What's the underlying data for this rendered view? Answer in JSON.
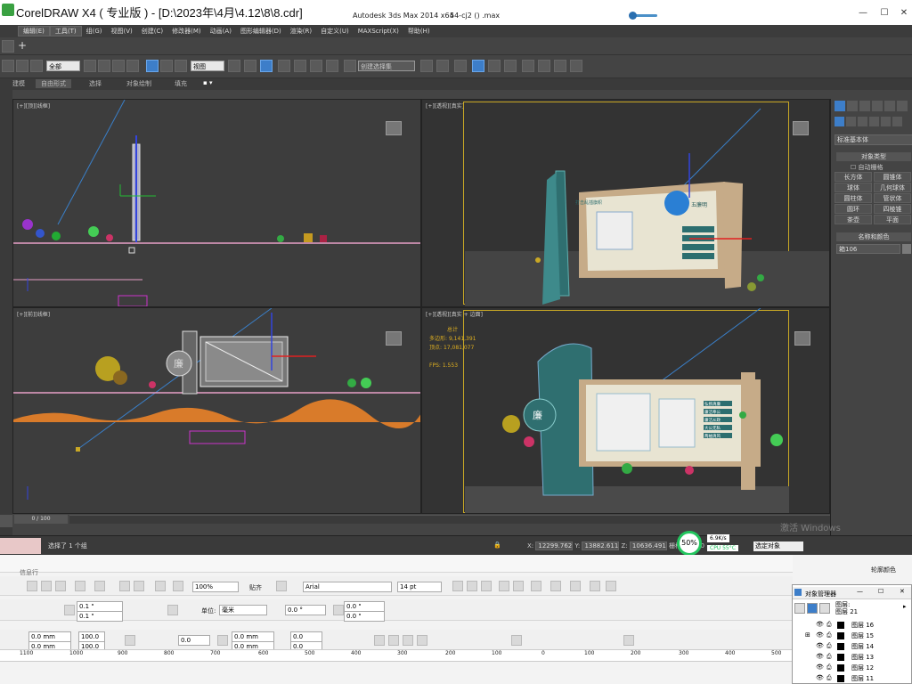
{
  "titlebar": {
    "corel_title": "CorelDRAW X4 ( 专业版 ) - [D:\\2023年\\4月\\4.12\\8\\8.cdr]",
    "max_title": "Autodesk 3ds Max  2014 x64",
    "max_file": "54-cj2 ()  .max"
  },
  "menus": [
    "编辑(E)",
    "工具(T)",
    "组(G)",
    "视图(V)",
    "创建(C)",
    "修改器(M)",
    "动画(A)",
    "图形编辑器(D)",
    "渲染(R)",
    "自定义(U)",
    "MAXScript(X)",
    "帮助(H)"
  ],
  "toolbar": {
    "selection_filter": "全部",
    "reference_coord": "视图",
    "named_selection": "创建选择集"
  },
  "ribbon_tabs": [
    "建模",
    "自由形式",
    "选择",
    "对象绘制",
    "填充"
  ],
  "viewports": {
    "top_left": "[+][顶][线框]",
    "top_right": "[+][透视][真实]",
    "bottom_left": "[+][前][线框]",
    "bottom_right": "[+][透视][真实 + 边面]",
    "stats": {
      "total_label": "总计",
      "polys_label": "多边形:",
      "polys": "9,141,391",
      "verts_label": "顶点:",
      "verts": "17,081,077",
      "fps_label": "FPS:",
      "fps": "1.553"
    }
  },
  "scene_text": {
    "sign_header": "打击乱插旗帜",
    "sign_title": "五廉明",
    "pillar_char": "廉",
    "lines": [
      "弘扬清廉",
      "廉洁奉公",
      "廉洁从政",
      "大公无私",
      "两袖清风"
    ]
  },
  "command_panel": {
    "dropdown": "标准基本体",
    "object_type_label": "对象类型",
    "autogrid": "自动栅格",
    "buttons": [
      "长方体",
      "圆锥体",
      "球体",
      "几何球体",
      "圆柱体",
      "管状体",
      "圆环",
      "四棱锥",
      "茶壶",
      "平面"
    ],
    "name_color_label": "名称和颜色",
    "object_name": "箱106"
  },
  "statusbar": {
    "timeline": "0 / 100",
    "status_text": "选择了 1 个组",
    "x_label": "X:",
    "x": "12299.762",
    "y_label": "Y:",
    "y": "13882.611",
    "z_label": "Z:",
    "z": "10636.491",
    "grid_label": "栅格 =",
    "grid": "10.0",
    "cpu_percent": "50%",
    "net_speed": "6.9K/s",
    "cpu_label": "CPU 55°C",
    "select_object": "选定对象",
    "activate_windows": "激活 Windows"
  },
  "corel": {
    "prompt": "信息行",
    "zoom": "100%",
    "snap": "贴齐",
    "font": "Arial",
    "font_size": "14 pt",
    "dim1": "0.1 \"",
    "dim2": "0.1 \"",
    "unit_label": "单位:",
    "unit": "毫米",
    "angle": "0.0 °",
    "dup1": "0.0 \"",
    "dup2": "0.0 \"",
    "mm1": "0.0 mm",
    "mm2": "0.0 mm",
    "pct1": "100.0",
    "pct2": "100.0",
    "rot": "0.0",
    "mm3": "0.0 mm",
    "mm4": "0.0 mm",
    "v1": "0.0",
    "v2": "0.0",
    "outline_color": "轮廓颜色",
    "ruler_ticks": [
      "1100",
      "1000",
      "900",
      "800",
      "700",
      "600",
      "500",
      "400",
      "300",
      "200",
      "100",
      "0",
      "100",
      "200",
      "300",
      "400",
      "500"
    ]
  },
  "object_manager": {
    "title": "对象管理器",
    "header_line1": "图层:",
    "header_line2": "图层 21",
    "layers": [
      "图层 16",
      "图层 15",
      "图层 14",
      "图层 13",
      "图层 12",
      "图层 11"
    ]
  },
  "colors": {
    "accent_blue": "#3d7ec9",
    "active_viewport": "#c9a825",
    "max_bg": "#444444",
    "cpu_green": "#22c55e"
  }
}
